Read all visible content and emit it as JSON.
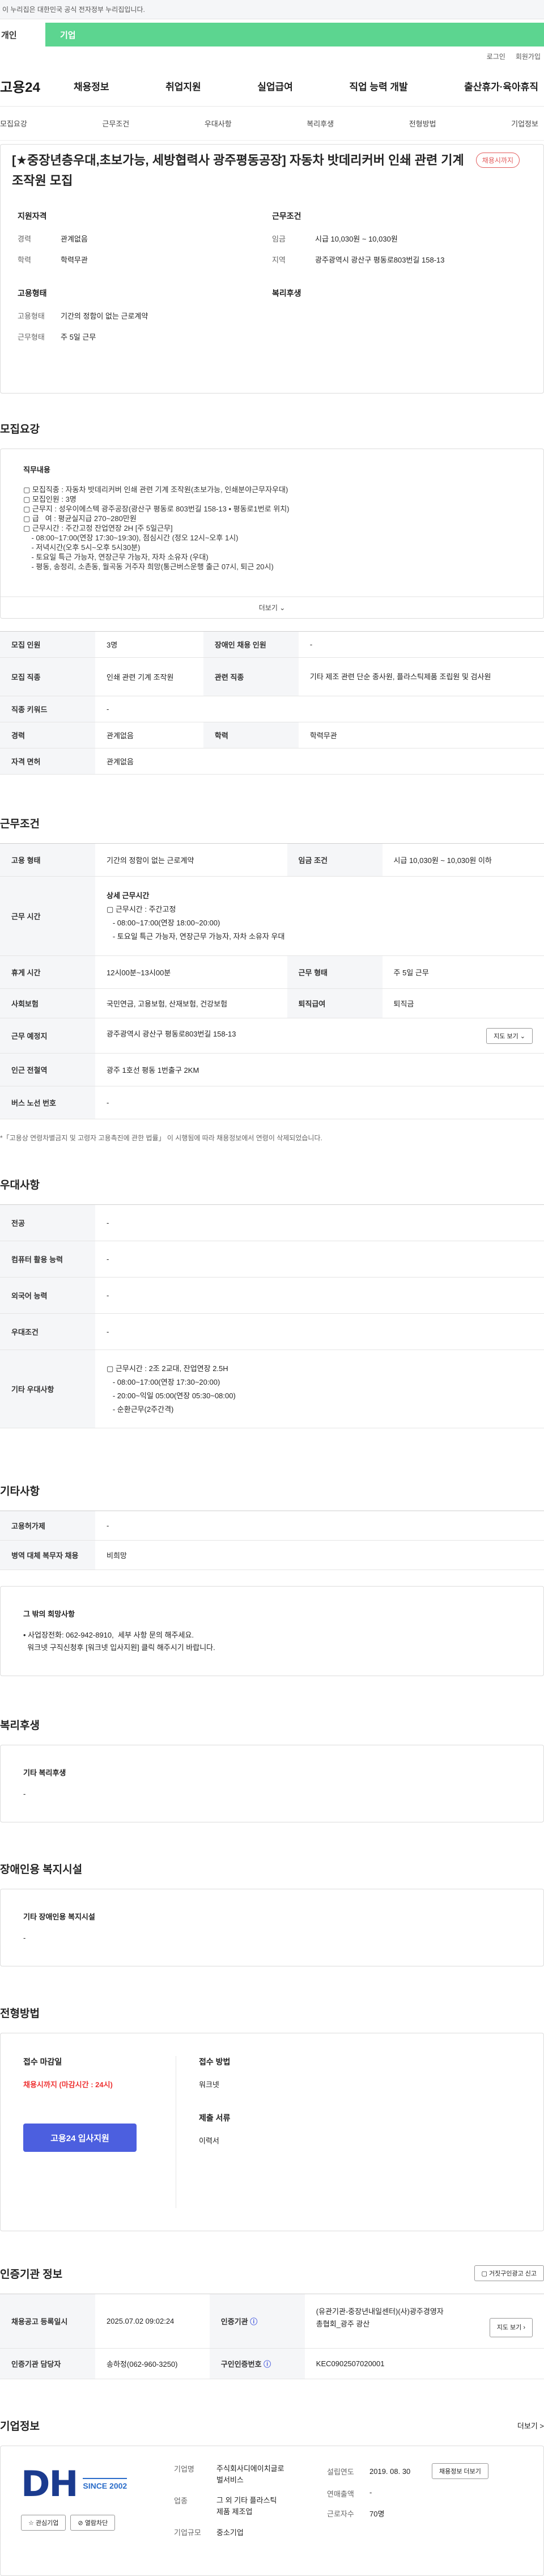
{
  "topbar": {
    "notice": "이 누리집은 대한민국 공식 전자정부 누리집입니다."
  },
  "usertabs": [
    "개인",
    "기업"
  ],
  "util": [
    "로그인",
    "회원가입"
  ],
  "gnb": {
    "logo": "고용24",
    "items": [
      "채용정보",
      "취업지원",
      "실업급여",
      "직업 능력 개발",
      "출산휴가·육아휴직"
    ]
  },
  "subnav": [
    "모집요강",
    "근무조건",
    "우대사항",
    "복리후생",
    "전형방법",
    "기업정보"
  ],
  "header": {
    "title": "[★중장년층우대,초보가능, 세방협력사 광주평동공장] 자동차 밧데리커버 인쇄 관련 기계 조작원 모집",
    "badge": "채용시까지",
    "qual": {
      "title": "지원자격",
      "rows": [
        [
          "경력",
          "관계없음"
        ],
        [
          "학력",
          "학력무관"
        ]
      ]
    },
    "cond": {
      "title": "근무조건",
      "rows": [
        [
          "임금",
          "시급 10,030원 ~ 10,030원"
        ],
        [
          "지역",
          "광주광역시 광산구 평동로803번길 158-13"
        ]
      ]
    },
    "emp": {
      "title": "고용형태",
      "rows": [
        [
          "고용형태",
          "기간의 정함이 없는 근로계약"
        ],
        [
          "근무형태",
          "주 5일 근무"
        ]
      ]
    },
    "welfare": {
      "title": "복리후생"
    }
  },
  "recruit": {
    "title": "모집요강",
    "duty_title": "직무내용",
    "duty_lines": [
      "▢ 모집직종 : 자동차 밧데리커버 인쇄 관련 기계 조작원(초보가능, 인쇄분야근무자우대)",
      "▢ 모집인원 : 3명",
      "▢ 근무지 : 성우이에스텍 광주공장(광산구 평동로 803번길 158-13 • 평동로1번로 위치)",
      "▢ 급   여 : 평균실지급 270~280만원",
      "▢ 근무시간 : 주간고정 잔업연장 2H [주 5일근무]",
      "    - 08:00~17:00(연장 17:30~19:30), 점심시간 (정오 12시~오후 1시)",
      "    - 저녁시간(오후 5시~오후 5시30분)",
      "    - 토요일 특근 가능자, 연장근무 가능자, 자차 소유자 (우대)",
      "    - 평동, 송정리, 소촌동, 월곡동 거주자 희망(통근버스운행 출근 07시, 퇴근 20시)"
    ],
    "more": "더보기",
    "table": [
      [
        "모집 인원",
        "3명",
        "장애인 채용 인원",
        "-"
      ],
      [
        "모집 직종",
        "인쇄 관련 기계 조작원",
        "관련 직종",
        "기타 제조 관련 단순 종사원, 플라스틱제품 조립원 및 검사원"
      ],
      [
        "직종 키워드",
        "-"
      ],
      [
        "경력",
        "관계없음",
        "학력",
        "학력무관"
      ],
      [
        "자격 면허",
        "관계없음"
      ]
    ]
  },
  "work": {
    "title": "근무조건",
    "type": [
      "고용 형태",
      "기간의 정함이 없는 근로계약",
      "임금 조건",
      "시급 10,030원 ~ 10,030원 이하"
    ],
    "hours_label": "근무 시간",
    "hours_title": "상세 근무시간",
    "hours_lines": [
      "▢ 근무시간 : 주간고정",
      "   - 08:00~17:00(연장 18:00~20:00)",
      "   - 토요일 특근 가능자, 연장근무 가능자, 자차 소유자 우대"
    ],
    "rest": [
      "휴게 시간",
      "12시00분~13시00분",
      "근무 형태",
      "주 5일 근무"
    ],
    "ins": [
      "사회보험",
      "국민연금, 고용보험, 산재보험, 건강보험",
      "퇴직급여",
      "퇴직금"
    ],
    "place": [
      "근무 예정지",
      "광주광역시 광산구 평동로803번길 158-13"
    ],
    "map_btn": "지도 보기",
    "subway": [
      "인근 전철역",
      "광주 1호선 평동 1번출구 2KM"
    ],
    "bus": [
      "버스 노선 번호",
      "-"
    ],
    "note": "*「고용상 연령차별금지 및 고령자 고용촉진에 관한 법률」 이 시행됨에 따라 채용정보에서 연령이 삭제되었습니다."
  },
  "pref": {
    "title": "우대사항",
    "rows": [
      [
        "전공",
        "-"
      ],
      [
        "컴퓨터 활용 능력",
        "-"
      ],
      [
        "외국어 능력",
        "-"
      ],
      [
        "우대조건",
        "-"
      ]
    ],
    "other_label": "기타 우대사항",
    "other_lines": [
      "▢ 근무시간 : 2조 2교대, 잔업연장 2.5H",
      "   - 08:00~17:00(연장 17:30~20:00)",
      "   - 20:00~익일 05:00(연장 05:30~08:00)",
      "   - 순환근무(2주간격)"
    ]
  },
  "etc": {
    "title": "기타사항",
    "rows": [
      [
        "고용허가제",
        "-"
      ],
      [
        "병역 대체 복무자 채용",
        "비희망"
      ]
    ],
    "box_title": "그 밖의 희망사항",
    "box_lines": [
      "• 사업장전화: 062-942-8910,  세부 사항 문의 해주세요.",
      "  워크넷 구직신청후 [워크넷 입사지원] 클릭 해주시기 바랍니다."
    ]
  },
  "welfare": {
    "title": "복리후생",
    "box_title": "기타 복리후생",
    "box_value": "-"
  },
  "disabled": {
    "title": "장애인용 복지시설",
    "box_title": "기타 장애인용 복지시설",
    "box_value": "-"
  },
  "apply": {
    "title": "전형방법",
    "deadline_t": "접수 마감일",
    "deadline_v": "채용시까지 (마감시간 : 24시)",
    "method_t": "접수 방법",
    "method_v": "워크넷",
    "docs_t": "제출 서류",
    "docs_v": "이력서",
    "btn": "고용24 입사지원"
  },
  "cert": {
    "title": "인증기관 정보",
    "btn": "거짓구인광고 신고",
    "rows": [
      [
        "채용공고 등록일시",
        "2025.07.02 09:02:24",
        "인증기관",
        "(유관기관-중장년내일센터)(사)광주경영자총협회_광주 광산"
      ],
      [
        "인증기관 담당자",
        "송하정(062-960-3250)",
        "구인인증번호",
        "KEC0902507020001"
      ]
    ],
    "map_btn": "지도 보기"
  },
  "company": {
    "title": "기업정보",
    "more": "더보기 >",
    "logo_text": "DH",
    "logo_since": "SINCE 2002",
    "fav": "관심기업",
    "hide": "열람차단",
    "rows": [
      [
        "기업명",
        "주식회사디에이치글로벌서비스"
      ],
      [
        "업종",
        "그 외 기타 플라스틱 제품 제조업"
      ],
      [
        "기업규모",
        "중소기업"
      ]
    ],
    "rows2": [
      [
        "설립연도",
        "2019. 08. 30"
      ],
      [
        "연매출액",
        "-"
      ],
      [
        "근로자수",
        "70명"
      ]
    ],
    "jobs_btn": "채용정보 더보기"
  }
}
